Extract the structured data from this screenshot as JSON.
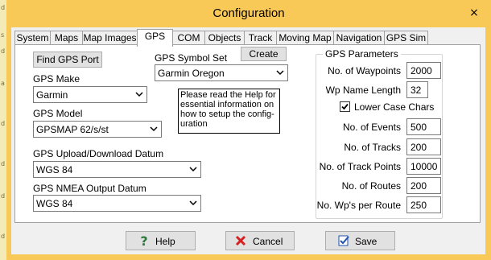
{
  "window": {
    "title": "Configuration",
    "close_glyph": "×"
  },
  "map": {
    "letters": [
      "d",
      "s",
      "d",
      "a",
      "d",
      "d",
      "d",
      "d"
    ]
  },
  "tabs": [
    {
      "label": "System"
    },
    {
      "label": "Maps"
    },
    {
      "label": "Map Images"
    },
    {
      "label": "GPS",
      "active": true
    },
    {
      "label": "COM"
    },
    {
      "label": "Objects"
    },
    {
      "label": "Track"
    },
    {
      "label": "Moving Map"
    },
    {
      "label": "Navigation"
    },
    {
      "label": "GPS Sim"
    }
  ],
  "gps": {
    "find_port_label": "Find GPS Port",
    "make_label": "GPS Make",
    "make_value": "Garmin",
    "model_label": "GPS Model",
    "model_value": "GPSMAP 62/s/st",
    "symbol_set_label": "GPS Symbol Set",
    "symbol_set_value": "Garmin Oregon",
    "create_label": "Create",
    "help_note": "Please read the Help for essential information on how to setup the configuration",
    "help_note_lines": [
      "Please read the Help for",
      "essential information on",
      "how to setup the config-",
      "uration"
    ],
    "upload_datum_label": "GPS Upload/Download Datum",
    "upload_datum_value": "WGS 84",
    "nmea_datum_label": "GPS NMEA Output Datum",
    "nmea_datum_value": "WGS 84"
  },
  "params": {
    "title": "GPS Parameters",
    "waypoints_label": "No. of Waypoints",
    "waypoints_value": "2000",
    "wp_name_length_label": "Wp Name Length",
    "wp_name_length_value": "32",
    "lowercase_label": "Lower Case Chars",
    "lowercase_checked": true,
    "events_label": "No. of Events",
    "events_value": "500",
    "tracks_label": "No. of Tracks",
    "tracks_value": "200",
    "track_points_label": "No. of Track Points",
    "track_points_value": "10000",
    "routes_label": "No. of Routes",
    "routes_value": "200",
    "wps_per_route_label": "No. Wp's per Route",
    "wps_per_route_value": "250"
  },
  "footer": {
    "help_label": "Help",
    "cancel_label": "Cancel",
    "save_label": "Save"
  },
  "colors": {
    "title_bar": "#f9c958",
    "help_icon": "#2a7a3a",
    "cancel_icon": "#d42020",
    "save_icon": "#2050b0"
  },
  "icons": {
    "help": "question-mark-icon",
    "cancel": "red-x-icon",
    "save": "check-document-icon"
  }
}
